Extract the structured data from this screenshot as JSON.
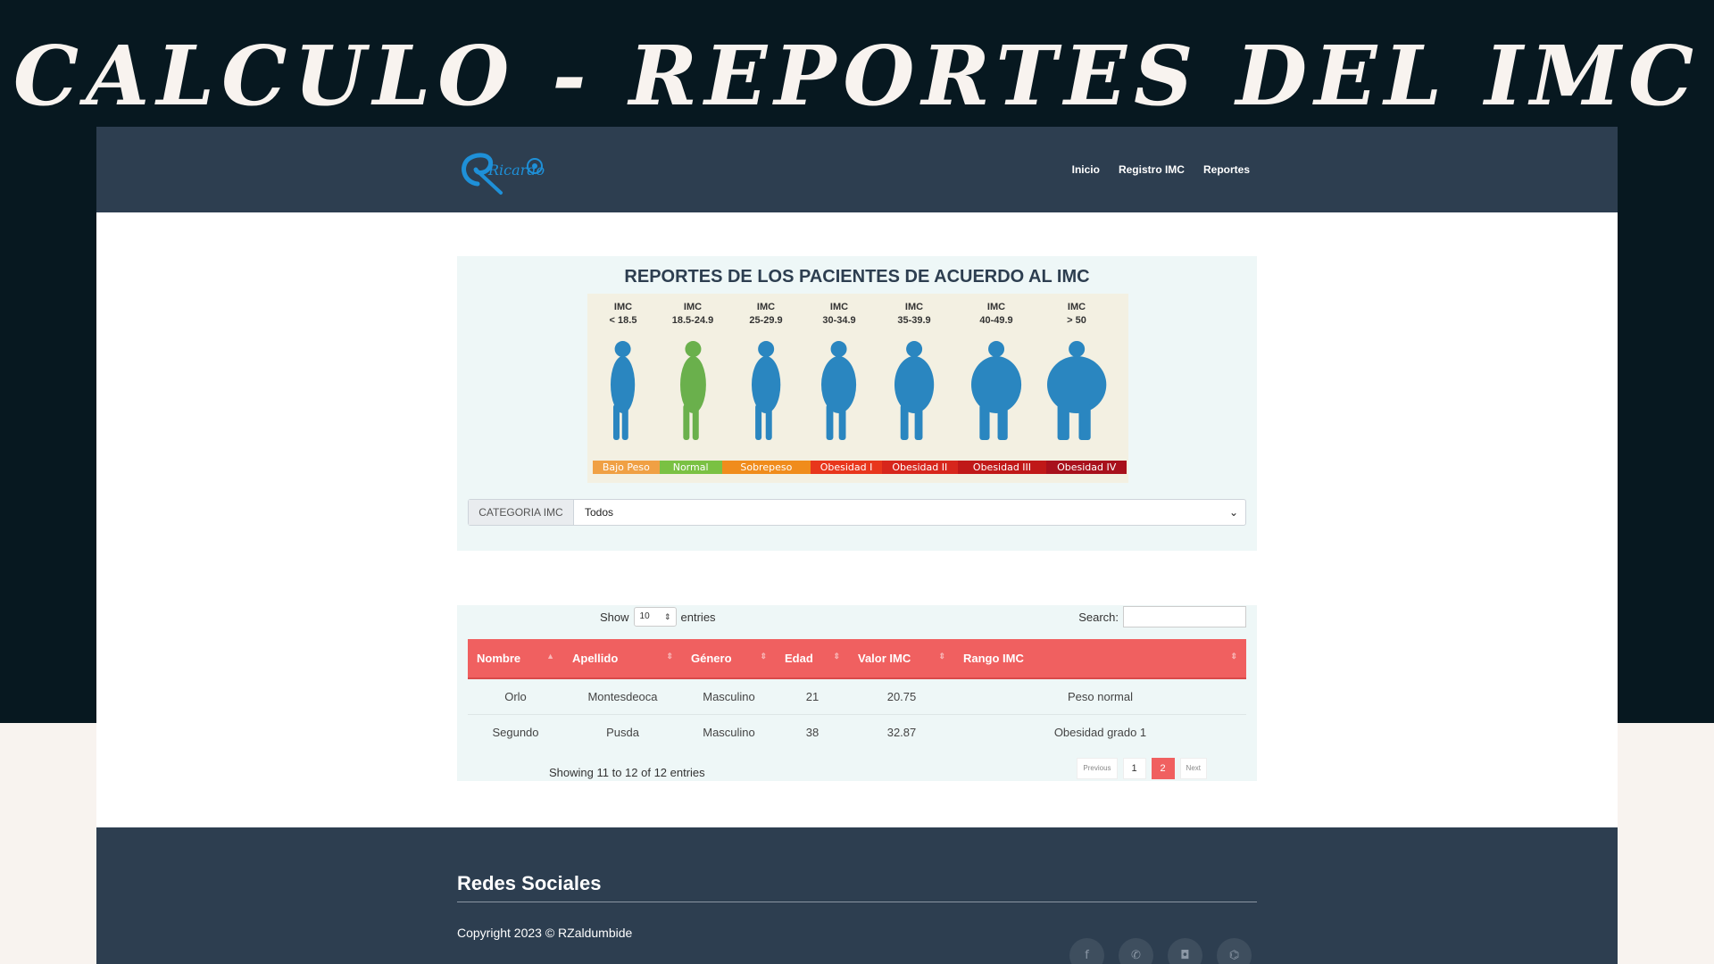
{
  "banner": {
    "title": "CALCULO - REPORTES DEL IMC"
  },
  "nav": {
    "logo_text": "Ricardo",
    "links": [
      "Inicio",
      "Registro IMC",
      "Reportes"
    ]
  },
  "report_panel": {
    "title": "REPORTES DE LOS PACIENTES DE ACUERDO AL IMC",
    "imc_ranges": [
      {
        "line1": "IMC",
        "line2": "< 18.5"
      },
      {
        "line1": "IMC",
        "line2": "18.5-24.9"
      },
      {
        "line1": "IMC",
        "line2": "25-29.9"
      },
      {
        "line1": "IMC",
        "line2": "30-34.9"
      },
      {
        "line1": "IMC",
        "line2": "35-39.9"
      },
      {
        "line1": "IMC",
        "line2": "40-49.9"
      },
      {
        "line1": "IMC",
        "line2": "> 50"
      }
    ],
    "categories": [
      {
        "label": "Bajo Peso",
        "color": "#f0a044"
      },
      {
        "label": "Normal",
        "color": "#7ac143"
      },
      {
        "label": "Sobrepeso",
        "color": "#f08c1c"
      },
      {
        "label": "Obesidad I",
        "color": "#e8361c"
      },
      {
        "label": "Obesidad II",
        "color": "#d7261c"
      },
      {
        "label": "Obesidad III",
        "color": "#c01818"
      },
      {
        "label": "Obesidad IV",
        "color": "#a8101c"
      }
    ],
    "select_label": "CATEGORIA IMC",
    "select_value": "Todos"
  },
  "table": {
    "show_label": "Show",
    "entries_label": "entries",
    "page_length": "10",
    "search_label": "Search:",
    "columns": [
      "Nombre",
      "Apellido",
      "Género",
      "Edad",
      "Valor IMC",
      "Rango IMC"
    ],
    "rows": [
      [
        "Orlo",
        "Montesdeoca",
        "Masculino",
        "21",
        "20.75",
        "Peso normal"
      ],
      [
        "Segundo",
        "Pusda",
        "Masculino",
        "38",
        "32.87",
        "Obesidad grado 1"
      ]
    ],
    "info": "Showing 11 to 12 of 12 entries",
    "pagination": {
      "previous": "Previous",
      "pages": [
        "1",
        "2"
      ],
      "current": "2",
      "next": "Next"
    }
  },
  "footer": {
    "title": "Redes Sociales",
    "copyright": "Copyright 2023 © RZaldumbide",
    "socials": [
      {
        "icon": "facebook-icon",
        "glyph": "f"
      },
      {
        "icon": "whatsapp-icon",
        "glyph": "✆"
      },
      {
        "icon": "instagram-icon",
        "glyph": "◘"
      },
      {
        "icon": "github-icon",
        "glyph": "⌬"
      }
    ]
  },
  "colors": {
    "banner_bg": "#071820",
    "nav_bg": "#2d3e50",
    "accent": "#f06060",
    "panel_bg": "#eef7f7",
    "figure_blue": "#2a86c0",
    "figure_green": "#6ab04c"
  }
}
